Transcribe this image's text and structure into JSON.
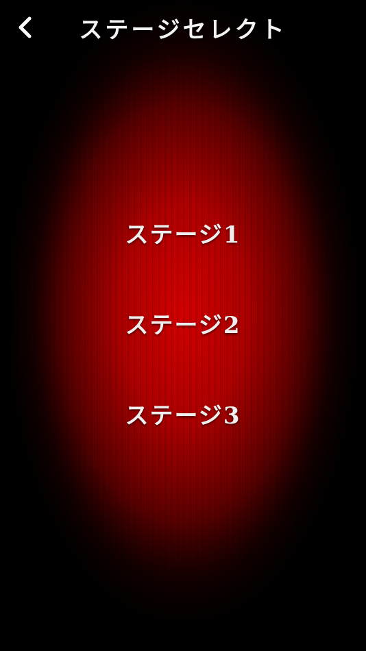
{
  "header": {
    "title": "ステージセレクト",
    "back_icon": "chevron-left-icon"
  },
  "stages": [
    {
      "label": "ステージ1"
    },
    {
      "label": "ステージ2"
    },
    {
      "label": "ステージ3"
    }
  ],
  "colors": {
    "background_center": "#e00000",
    "background_edge": "#000000",
    "text": "#f4f4f4"
  }
}
